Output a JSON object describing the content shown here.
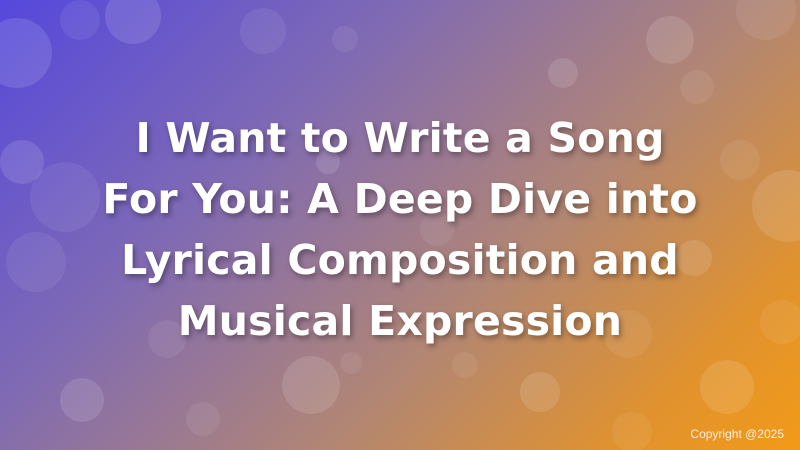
{
  "banner": {
    "title_lines": [
      "I Want to Write a Song",
      "For You: A Deep Dive into",
      "Lyrical Composition and",
      "Musical Expression"
    ],
    "copyright": "Copyright @2025"
  },
  "colors": {
    "gradient_start": "#5548dc",
    "gradient_end": "#f29a18",
    "text": "#ffffff"
  }
}
